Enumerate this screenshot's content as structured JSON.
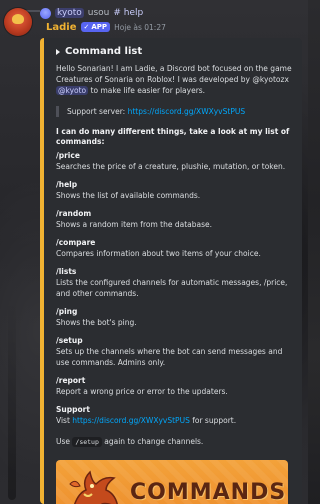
{
  "reply": {
    "user": "kyoto",
    "action": "usou",
    "command_hash": "#",
    "command": "help"
  },
  "message": {
    "author": "Ladie",
    "badge": "APP",
    "timestamp": "Hoje às 01:27"
  },
  "embed": {
    "accent": "#f0b232",
    "title": "Command list",
    "intro_1": "Hello Sonarian! I am Ladie, a Discord bot focused on the game Creatures of Sonaria on Roblox! I was developed by @kyotozx ",
    "intro_mention": "@kyoto",
    "intro_2": " to make life easier for players.",
    "support_label": "Support server: ",
    "support_link": "https://discord.gg/XWXyvStPUS",
    "can_do": "I can do many different things, take a look at my list of commands:",
    "commands": [
      {
        "name": "/price",
        "desc": "Searches the price of a creature, plushie, mutation, or token."
      },
      {
        "name": "/help",
        "desc": "Shows the list of available commands."
      },
      {
        "name": "/random",
        "desc": "Shows a random item from the database."
      },
      {
        "name": "/compare",
        "desc": "Compares information about two items of your choice."
      },
      {
        "name": "/lists",
        "desc": "Lists the configured channels for automatic messages, /price, and other commands."
      },
      {
        "name": "/ping",
        "desc": "Shows the bot's ping."
      },
      {
        "name": "/setup",
        "desc": "Sets up the channels where the bot can send messages and use commands. Admins only."
      },
      {
        "name": "/report",
        "desc": "Report a wrong price or error to the updaters."
      }
    ],
    "support_title": "Support",
    "support_visit": "Vist ",
    "support_visit_link": "https://discord.gg/XWXyvStPUS",
    "support_visit_end": " for support.",
    "use_1": "Use ",
    "use_code": "/setup",
    "use_2": " again to change channels.",
    "banner_text": "COMMANDS"
  }
}
